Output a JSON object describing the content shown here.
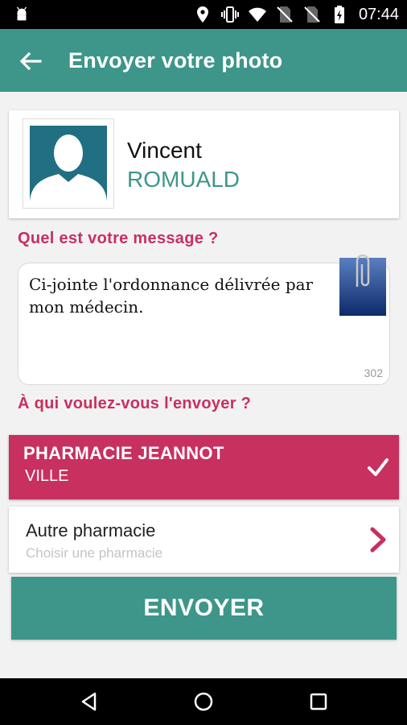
{
  "status_bar": {
    "time": "07:44",
    "icons": [
      "android-debug-icon",
      "location-icon",
      "vibrate-icon",
      "wifi-icon",
      "no-sim-icon",
      "no-sim-icon",
      "battery-charging-icon"
    ]
  },
  "app_bar": {
    "title": "Envoyer votre photo",
    "back_icon": "arrow-left-icon"
  },
  "profile": {
    "first_name": "Vincent",
    "last_name": "ROMUALD",
    "avatar_icon": "person-silhouette-icon"
  },
  "message_section": {
    "label": "Quel est votre message ?",
    "text": "Ci-jointe l'ordonnance délivrée par mon médecin.",
    "char_count": "302",
    "attachment_icon": "attached-photo-icon"
  },
  "recipient_section": {
    "label": "À qui voulez-vous l'envoyer ?",
    "selected_pharmacy": {
      "name": "PHARMACIE JEANNOT",
      "city": "VILLE",
      "icon": "checkmark-icon"
    },
    "other_pharmacy": {
      "title": "Autre pharmacie",
      "subtitle": "Choisir une pharmacie",
      "icon": "chevron-right-icon"
    }
  },
  "send_button": {
    "label": "ENVOYER"
  },
  "colors": {
    "primary": "#3d9689",
    "accent": "#c8305f",
    "background": "#f2f2f2"
  },
  "nav_bar": {
    "icons": [
      "back-triangle-icon",
      "home-circle-icon",
      "recents-square-icon"
    ]
  }
}
